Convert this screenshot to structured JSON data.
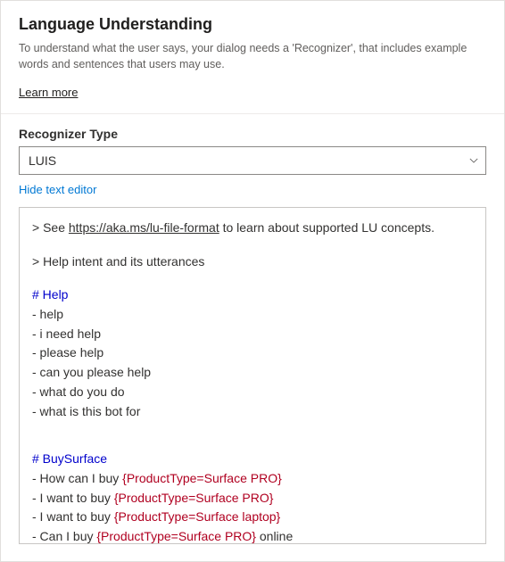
{
  "header": {
    "title": "Language Understanding",
    "description": "To understand what the user says, your dialog needs a 'Recognizer', that includes example words and sentences that users may use.",
    "learn_more": "Learn more"
  },
  "recognizer": {
    "label": "Recognizer Type",
    "value": "LUIS"
  },
  "toggle": {
    "label": "Hide text editor"
  },
  "editor": {
    "comment1_prefix": "> See ",
    "comment1_link": "https://aka.ms/lu-file-format",
    "comment1_suffix": " to learn about supported LU concepts.",
    "comment2": "> Help intent and its utterances",
    "intent1": "# Help",
    "help_utts": [
      "- help",
      "- i need help",
      "- please help",
      "- can you please help",
      "- what do you do",
      "- what is this bot for"
    ],
    "intent2": "# BuySurface",
    "buy": [
      {
        "pre": "- How can I buy ",
        "ent": "{ProductType=Surface PRO}",
        "post": ""
      },
      {
        "pre": "- I want to buy ",
        "ent": "{ProductType=Surface PRO}",
        "post": ""
      },
      {
        "pre": "- I want to buy ",
        "ent": "{ProductType=Surface laptop}",
        "post": ""
      },
      {
        "pre": "- Can I buy ",
        "ent": "{ProductType=Surface PRO}",
        "post": " online"
      }
    ]
  }
}
